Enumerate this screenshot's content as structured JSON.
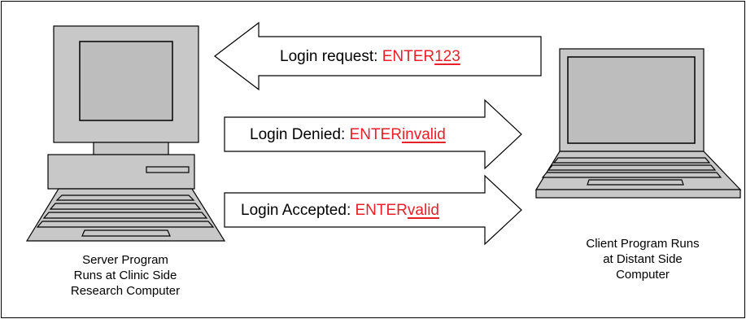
{
  "messages": {
    "request": {
      "label": "Login request: ",
      "code_prefix": "ENTER",
      "code_suffix": "123"
    },
    "denied": {
      "label": "Login Denied: ",
      "code_prefix": "ENTER",
      "code_suffix": "invalid"
    },
    "accepted": {
      "label": "Login Accepted: ",
      "code_prefix": "ENTER",
      "code_suffix": "valid"
    }
  },
  "server": {
    "caption": [
      "Server Program",
      "Runs at Clinic Side",
      "Research Computer"
    ]
  },
  "client": {
    "caption": [
      "Client Program Runs",
      "at Distant Side",
      "Computer"
    ]
  },
  "colors": {
    "code": "#e8202a",
    "device_fill": "#c8c8c8",
    "screen": "#bdbdbd",
    "arrow_fill": "#ffffff",
    "outline": "#000000"
  }
}
